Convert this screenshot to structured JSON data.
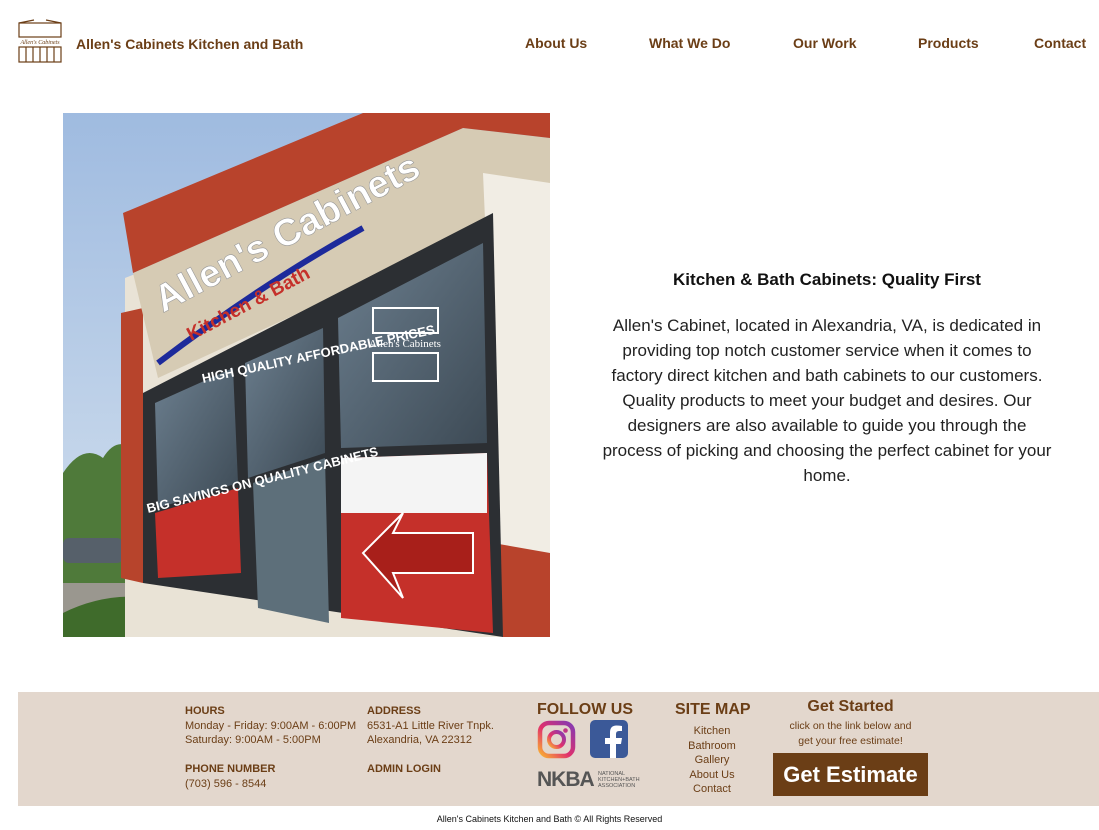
{
  "header": {
    "site_title": "Allen's Cabinets Kitchen and Bath",
    "logo_text": "Allen's Cabinets",
    "nav": [
      "About Us",
      "What We Do",
      "Our Work",
      "Products",
      "Contact"
    ]
  },
  "photo": {
    "sign_main": "Allen's Cabinets",
    "sign_sub": "Kitchen & Bath",
    "window_logo": "Allen's Cabinets",
    "window_text_1": "HIGH QUALITY AFFORDABLE PRICES",
    "window_text_2": "BIG SAVINGS ON QUALITY CABINETS"
  },
  "intro": {
    "title": "Kitchen & Bath Cabinets: Quality First",
    "body": "Allen's Cabinet, located in Alexandria, VA, is dedicated in providing top notch customer service when it comes to factory direct kitchen and bath cabinets to our customers. Quality products to meet your budget and desires. Our designers are also available to guide you through the process of picking and choosing the perfect cabinet for your home."
  },
  "footer": {
    "hours_label": "HOURS",
    "hours_line1": "Monday - Friday: 9:00AM - 6:00PM",
    "hours_line2": "Saturday: 9:00AM - 5:00PM",
    "phone_label": "PHONE NUMBER",
    "phone": "(703) 596 - 8544",
    "address_label": "ADDRESS",
    "address_line1": "6531-A1 Little River Tnpk.",
    "address_line2": "Alexandria, VA 22312",
    "admin_login": "ADMIN LOGIN",
    "follow_us": "FOLLOW US",
    "nkba_letters": "NKBA",
    "nkba_text1": "NATIONAL",
    "nkba_text2": "KITCHEN+BATH",
    "nkba_text3": "ASSOCIATION",
    "sitemap_title": "SITE MAP",
    "sitemap_items": [
      "Kitchen",
      "Bathroom",
      "Gallery",
      "About Us",
      "Contact"
    ],
    "get_started": "Get Started",
    "get_started_sub1": "click on the link below and",
    "get_started_sub2": "get your free estimate!",
    "estimate_button": "Get Estimate"
  },
  "copyright": "Allen's Cabinets Kitchen and Bath © All Rights Reserved",
  "colors": {
    "brand_brown": "#6b3e16",
    "footer_bg": "#e3d7cd",
    "sign_red": "#c5302a"
  },
  "icons": [
    "logo-icon",
    "instagram-icon",
    "facebook-icon",
    "nkba-logo"
  ]
}
